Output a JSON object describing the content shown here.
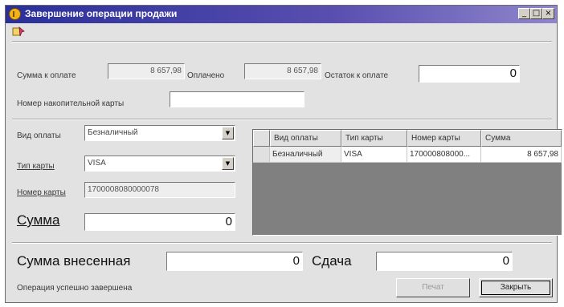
{
  "window": {
    "title": "Завершение операции продажи"
  },
  "summary": {
    "to_pay_label": "Сумма к оплате",
    "to_pay_value": "8 657,98",
    "paid_label": "Оплачено",
    "paid_value": "8 657,98",
    "remaining_label": "Остаток к оплате",
    "remaining_value": "0",
    "card_label": "Номер накопительной карты",
    "card_value": ""
  },
  "payment": {
    "type_label": "Вид оплаты",
    "type_value": "Безналичный",
    "card_type_label": "Тип карты",
    "card_type_value": "VISA",
    "card_number_label": "Номер карты",
    "card_number_value": "1700008080000078",
    "sum_label": "Сумма",
    "sum_value": "0"
  },
  "table": {
    "columns": [
      "Вид оплаты",
      "Тип карты",
      "Номер карты",
      "Сумма"
    ],
    "rows": [
      [
        "Безналичный",
        "VISA",
        "170000808000...",
        "8 657,98"
      ]
    ]
  },
  "footer": {
    "deposited_label": "Сумма внесенная",
    "deposited_value": "0",
    "change_label": "Сдача",
    "change_value": "0",
    "status": "Операция успешно завершена",
    "print_label": "Печат",
    "close_label": "Закрыть"
  },
  "titlebar_buttons": {
    "minimize": "_",
    "maximize": "□",
    "close": "×"
  },
  "icons": {
    "app": "coin-icon",
    "toolbar": "pin-icon"
  },
  "colors": {
    "titlebar": "#2a2f9a",
    "window_bg": "#e2e2e2",
    "grid_bg": "#808080"
  }
}
